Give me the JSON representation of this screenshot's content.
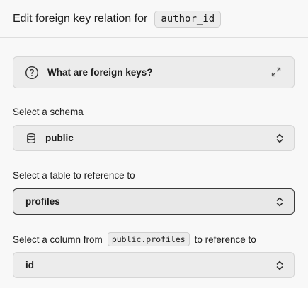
{
  "header": {
    "title": "Edit foreign key relation for",
    "column": "author_id"
  },
  "info": {
    "label": "What are foreign keys?"
  },
  "schema": {
    "label": "Select a schema",
    "value": "public"
  },
  "table": {
    "label": "Select a table to reference to",
    "value": "profiles"
  },
  "column": {
    "label_prefix": "Select a column from",
    "label_code": "public.profiles",
    "label_suffix": "to reference to",
    "value": "id"
  },
  "icons": {
    "info": "question-circle-icon",
    "expand": "expand-icon",
    "schema": "database-icon",
    "dropdown": "chevron-up-down-icon"
  }
}
